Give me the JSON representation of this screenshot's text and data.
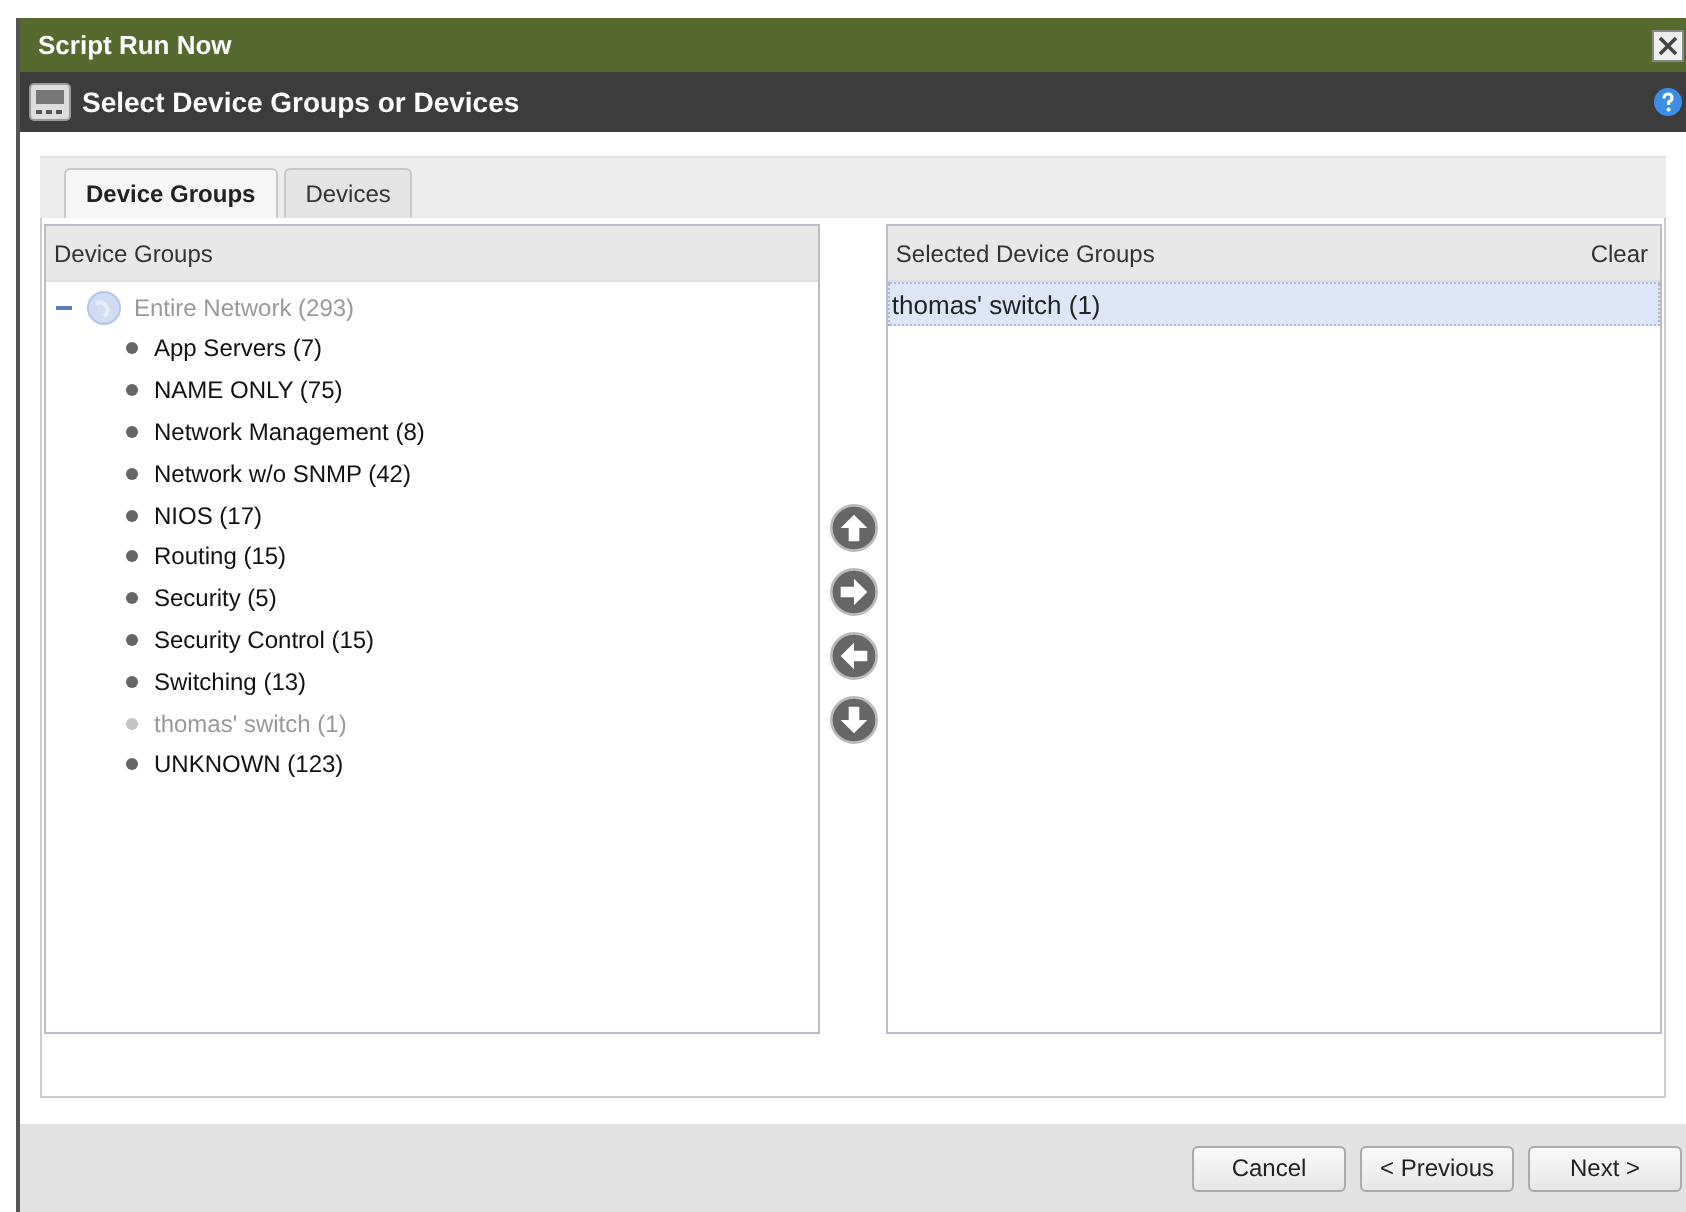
{
  "window": {
    "title": "Script Run Now"
  },
  "header": {
    "title": "Select Device Groups or Devices"
  },
  "tabs": [
    {
      "label": "Device Groups",
      "selected": true
    },
    {
      "label": "Devices",
      "selected": false
    }
  ],
  "tree": {
    "heading": "Device Groups",
    "root": {
      "label": "Entire Network (293)",
      "expanded": true,
      "disabled": true,
      "children": [
        {
          "label": "App Servers (7)",
          "disabled": false
        },
        {
          "label": "NAME ONLY (75)",
          "disabled": false
        },
        {
          "label": "Network Management (8)",
          "disabled": false
        },
        {
          "label": "Network w/o SNMP (42)",
          "disabled": false
        },
        {
          "label": "NIOS (17)",
          "disabled": false
        },
        {
          "label": "Routing (15)",
          "disabled": false
        },
        {
          "label": "Security (5)",
          "disabled": false
        },
        {
          "label": "Security Control (15)",
          "disabled": false
        },
        {
          "label": "Switching (13)",
          "disabled": false
        },
        {
          "label": "thomas' switch (1)",
          "disabled": true
        },
        {
          "label": "UNKNOWN (123)",
          "disabled": false
        }
      ]
    }
  },
  "selected_list": {
    "heading": "Selected Device Groups",
    "clear": "Clear",
    "items": [
      {
        "label": "thomas' switch (1)",
        "selected": true
      }
    ]
  },
  "buttons": [
    "Cancel",
    "< Previous",
    "Next >"
  ]
}
